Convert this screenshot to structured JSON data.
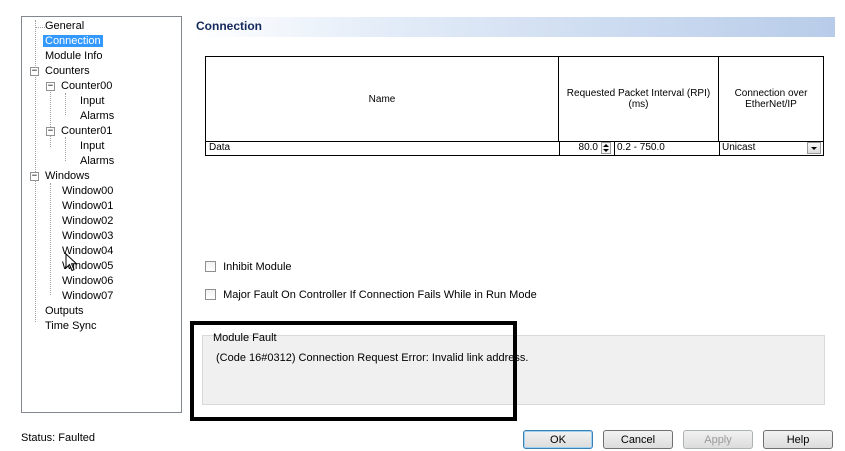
{
  "tree": {
    "items": [
      {
        "label": "General"
      },
      {
        "label": "Connection"
      },
      {
        "label": "Module Info"
      },
      {
        "label": "Counters"
      },
      {
        "label": "Counter00"
      },
      {
        "label": "Input"
      },
      {
        "label": "Alarms"
      },
      {
        "label": "Counter01"
      },
      {
        "label": "Input"
      },
      {
        "label": "Alarms"
      },
      {
        "label": "Windows"
      },
      {
        "label": "Window00"
      },
      {
        "label": "Window01"
      },
      {
        "label": "Window02"
      },
      {
        "label": "Window03"
      },
      {
        "label": "Window04"
      },
      {
        "label": "Window05"
      },
      {
        "label": "Window06"
      },
      {
        "label": "Window07"
      },
      {
        "label": "Outputs"
      },
      {
        "label": "Time Sync"
      }
    ],
    "selected": "Connection",
    "collapse_glyph": "−"
  },
  "header": {
    "title": "Connection"
  },
  "grid": {
    "columns": [
      "Name",
      "Requested Packet Interval (RPI)\n(ms)",
      "Connection over\nEtherNet/IP"
    ],
    "rows": [
      {
        "name": "Data",
        "rpi": "80.0",
        "range": "0.2 - 750.0",
        "connection": "Unicast"
      }
    ]
  },
  "options": {
    "inhibit_module": "Inhibit Module",
    "major_fault": "Major Fault On Controller If Connection Fails While in Run Mode"
  },
  "module_fault": {
    "title": "Module Fault",
    "message": "(Code 16#0312) Connection Request Error: Invalid link address."
  },
  "status": {
    "text": "Status:  Faulted"
  },
  "buttons": {
    "ok": "OK",
    "cancel": "Cancel",
    "apply": "Apply",
    "help": "Help"
  },
  "colors": {
    "selection": "#3399ff",
    "header_gradient_end": "#b8cce9"
  }
}
